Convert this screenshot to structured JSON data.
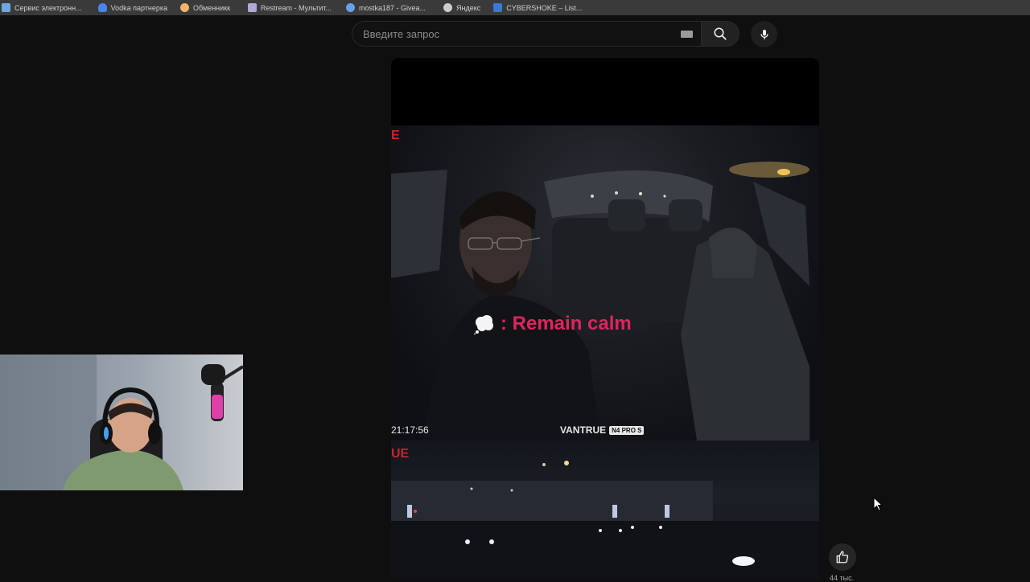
{
  "bookmarks": [
    {
      "label": "Сервис электронн...",
      "icon": "page-icon",
      "color": "#6fa8dc"
    },
    {
      "label": "Vodka партнерка",
      "icon": "shield-icon",
      "color": "#4a86e8"
    },
    {
      "label": "Обменникк",
      "icon": "exchange-icon",
      "color": "#f6b26b"
    },
    {
      "label": "Restream - Мультит...",
      "icon": "restream-icon",
      "color": "#b4a7d6"
    },
    {
      "label": "mostka187 - Givea...",
      "icon": "globe-icon",
      "color": "#6d9eeb"
    },
    {
      "label": "Яндекс",
      "icon": "globe-icon",
      "color": "#cccccc"
    },
    {
      "label": "CYBERSHOKE – List...",
      "icon": "cybershoke-icon",
      "color": "#3c78d8"
    }
  ],
  "search": {
    "placeholder": "Введите запрос",
    "icons": [
      "keyboard-icon",
      "search-icon",
      "microphone-icon"
    ]
  },
  "video": {
    "caption": ": Remain calm",
    "caption_icon": "thought-bubble-icon",
    "caption_color": "#e0245e",
    "timestamp": "21:17:56",
    "brand": "VANTRUE",
    "brand_model": "N4 PRO S",
    "fragment_top": "E",
    "fragment_bottom": "UE"
  },
  "actions": {
    "like_icon": "thumbs-up-icon",
    "like_count": "44 тыс."
  }
}
